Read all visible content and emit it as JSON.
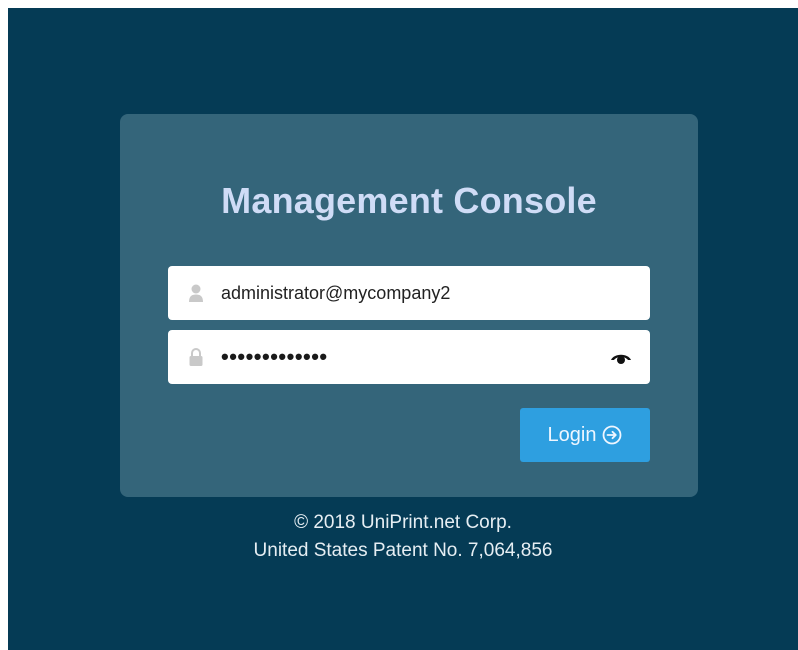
{
  "login_card": {
    "title": "Management Console",
    "username": {
      "value": "administrator@mycompany2",
      "icon": "user-icon"
    },
    "password": {
      "masked_value": "•••••••••••••",
      "icon": "lock-icon",
      "reveal_icon": "eye-icon"
    },
    "login_button": {
      "label": "Login",
      "icon": "arrow-circle-right-icon"
    }
  },
  "footer": {
    "copyright": "© 2018 UniPrint.net Corp.",
    "patent": "United States Patent No. 7,064,856"
  },
  "colors": {
    "background": "#053b55",
    "card": "#34657a",
    "title": "#cfdcf6",
    "button": "#2e9fe0"
  }
}
